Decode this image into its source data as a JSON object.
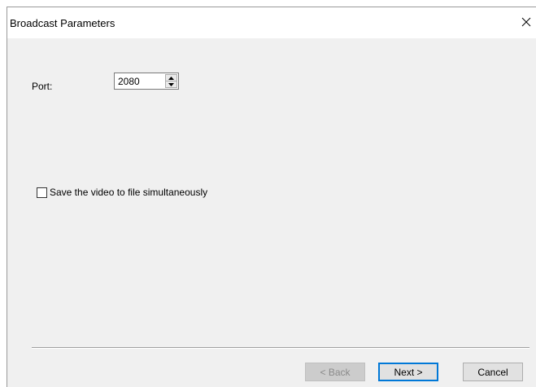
{
  "window": {
    "title": "Broadcast Parameters",
    "close_icon": "close-icon"
  },
  "port": {
    "label": "Port:",
    "value": "2080"
  },
  "save_option": {
    "label": "Save the video to file simultaneously",
    "checked": false
  },
  "buttons": {
    "back": "< Back",
    "next": "Next >",
    "cancel": "Cancel"
  },
  "colors": {
    "dialog_bg": "#f0f0f0",
    "titlebar_bg": "#ffffff",
    "focus_accent": "#0078d7"
  }
}
